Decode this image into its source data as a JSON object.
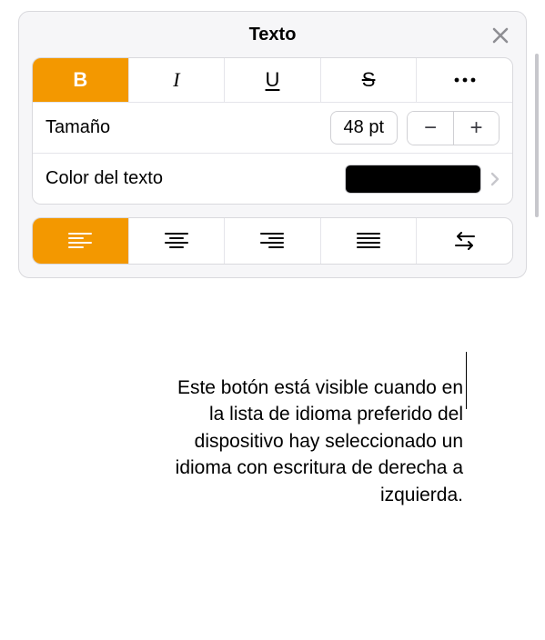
{
  "header": {
    "title": "Texto"
  },
  "format": {
    "bold_label": "B",
    "italic_label": "I",
    "underline_label": "U",
    "strike_label": "S"
  },
  "size": {
    "label": "Tamaño",
    "value": "48 pt",
    "minus": "−",
    "plus": "+"
  },
  "text_color": {
    "label": "Color del texto",
    "swatch": "#000000"
  },
  "callout": {
    "text": "Este botón está visible cuando en la lista de idioma preferido del dispositivo hay seleccionado un idioma con escritura de derecha a izquierda."
  }
}
